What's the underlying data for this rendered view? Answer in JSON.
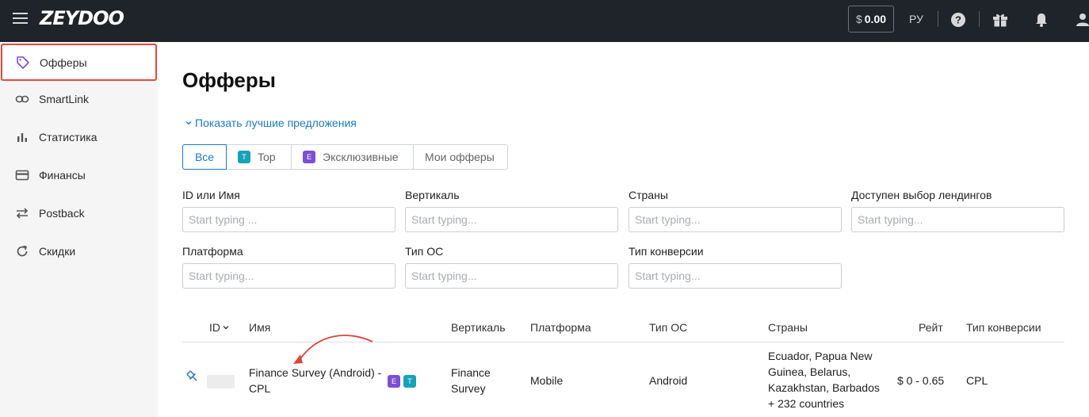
{
  "header": {
    "logo": "ZEYDOO",
    "balance_currency": "$",
    "balance_value": "0.00",
    "language": "РУ"
  },
  "sidebar": {
    "items": [
      {
        "label": "Офферы",
        "icon": "tag-icon",
        "active": true
      },
      {
        "label": "SmartLink",
        "icon": "link-icon"
      },
      {
        "label": "Статистика",
        "icon": "bar-chart-icon"
      },
      {
        "label": "Финансы",
        "icon": "credit-card-icon"
      },
      {
        "label": "Postback",
        "icon": "swap-arrows-icon"
      },
      {
        "label": "Скидки",
        "icon": "refresh-icon"
      }
    ]
  },
  "main": {
    "title": "Офферы",
    "show_best_link": "Показать лучшие предложения",
    "tabs": [
      {
        "label": "Все",
        "active": true
      },
      {
        "label": "Top",
        "badge": "T"
      },
      {
        "label": "Эксклюзивные",
        "badge": "E"
      },
      {
        "label": "Мои офферы"
      }
    ],
    "filters": [
      {
        "label": "ID или Имя",
        "placeholder": "Start typing ..."
      },
      {
        "label": "Вертикаль",
        "placeholder": "Start typing..."
      },
      {
        "label": "Страны",
        "placeholder": "Start typing..."
      },
      {
        "label": "Доступен выбор лендингов",
        "placeholder": "Start typing..."
      },
      {
        "label": "Платформа",
        "placeholder": "Start typing..."
      },
      {
        "label": "Тип ОС",
        "placeholder": "Start typing..."
      },
      {
        "label": "Тип конверсии",
        "placeholder": "Start typing..."
      }
    ]
  },
  "table": {
    "columns": [
      "ID",
      "Имя",
      "Вертикаль",
      "Платформа",
      "Тип ОС",
      "Страны",
      "Рейт",
      "Тип конверсии"
    ],
    "rows": [
      {
        "name_line1": "Finance Survey (Android) -",
        "name_line2": "CPL",
        "badges": [
          "E",
          "T"
        ],
        "vertical_line1": "Finance",
        "vertical_line2": "Survey",
        "platform": "Mobile",
        "os": "Android",
        "countries_line1": "Ecuador, Papua New",
        "countries_line2": "Guinea, Belarus,",
        "countries_line3": "Kazakhstan, Barbados",
        "countries_more": "+ 232 countries",
        "rate": "$ 0 - 0.65",
        "conversion": "CPL"
      }
    ]
  },
  "colors": {
    "accent": "#1a7ac7",
    "topbar": "#1f242b",
    "highlight": "#e24b40",
    "badge_top": "#17a2b8",
    "badge_exclusive": "#7b4fd6"
  }
}
